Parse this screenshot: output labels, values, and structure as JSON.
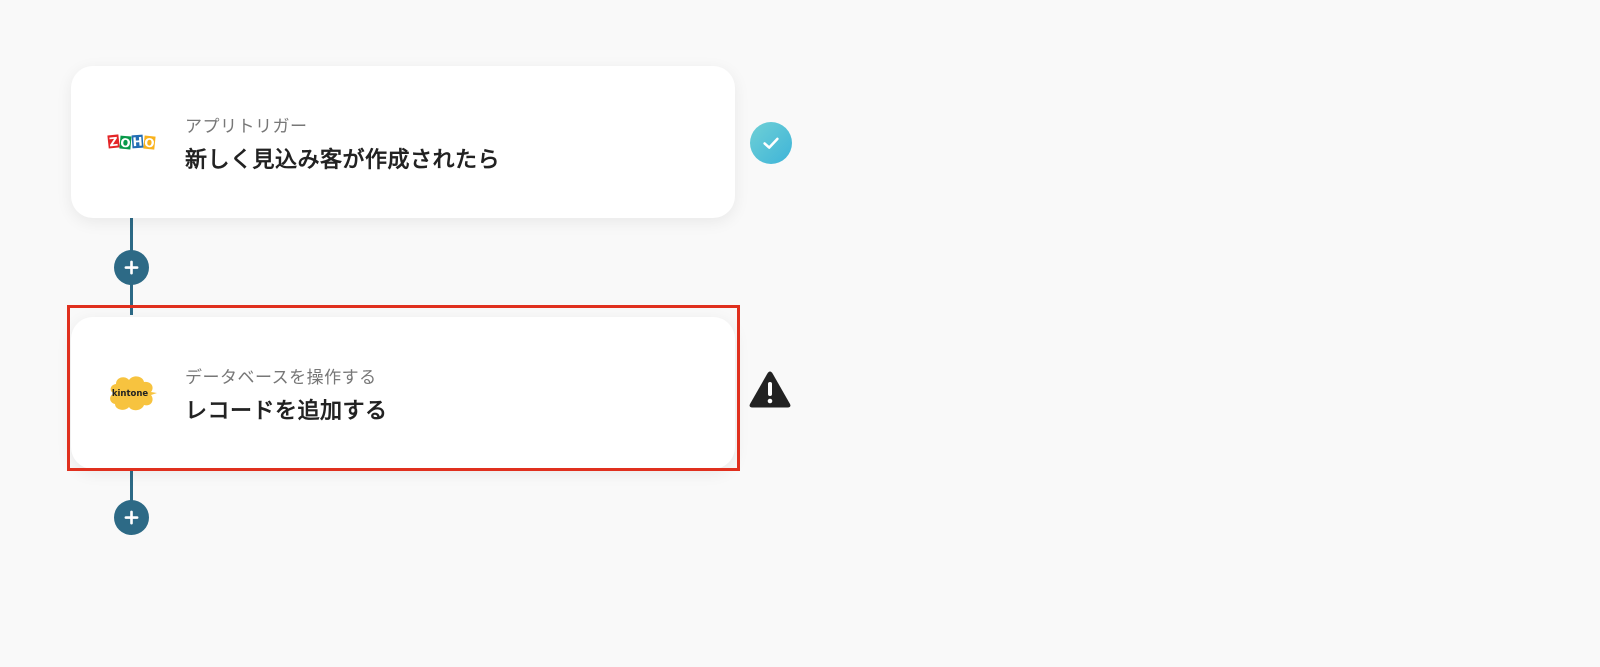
{
  "flow": {
    "steps": [
      {
        "app_icon": "zoho-logo",
        "logo_letters": [
          "Z",
          "O",
          "H",
          "O"
        ],
        "subtitle": "アプリトリガー",
        "title": "新しく見込み客が作成されたら",
        "status": "completed",
        "status_icon": "check-circle-icon"
      },
      {
        "app_icon": "kintone-logo",
        "logo_text": "kintone",
        "subtitle": "データベースを操作する",
        "title": "レコードを追加する",
        "status": "warning",
        "status_icon": "warning-triangle-icon",
        "highlighted": true
      }
    ],
    "add_step_icon": "plus-icon"
  },
  "colors": {
    "background": "#f9f9f9",
    "connector": "#2d6a86",
    "highlight_border": "#e0301e",
    "check_gradient_start": "#6fd0d6",
    "check_gradient_end": "#3eb4d8",
    "warning": "#222222",
    "kintone_yellow": "#f7c33f"
  }
}
